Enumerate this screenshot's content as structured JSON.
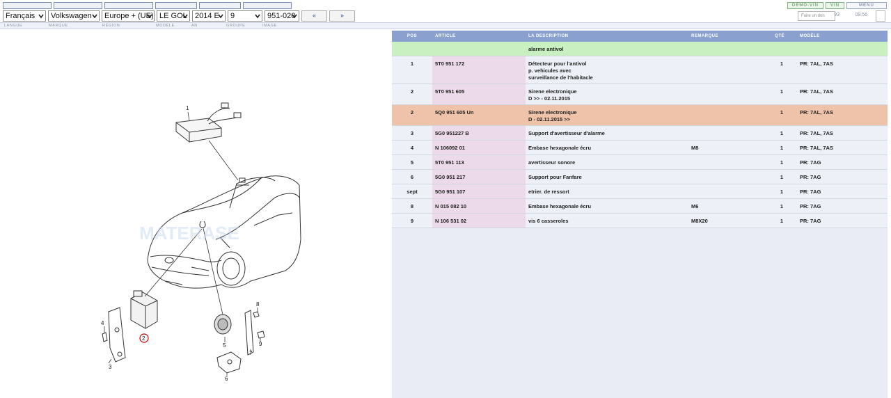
{
  "topbar": {
    "buttons": [
      "DÉMO-VIN",
      "VIN",
      "MENU"
    ]
  },
  "selectors": {
    "language": "Français",
    "brand": "Volkswagen",
    "region": "Europe + (UE)",
    "model": "LE GOL",
    "year": "2014 E",
    "group": "9",
    "image": "951-020",
    "prev": "«",
    "next": "»"
  },
  "labels": {
    "language": "LANGUE",
    "brand": "MARQUE",
    "region": "RÉGION",
    "model": "MODÈLE",
    "year": "AN",
    "group": "GROUPE",
    "image": "IMAGE"
  },
  "search": {
    "placeholder": "Faire un don"
  },
  "counters": {
    "a": "93",
    "b": "09:56"
  },
  "diagram": {
    "callouts": [
      "1",
      "2",
      "3",
      "4",
      "5",
      "6",
      "7",
      "8",
      "9"
    ]
  },
  "table": {
    "headers": {
      "pos": "POS",
      "article": "ARTICLE",
      "description": "LA DESCRIPTION",
      "remark": "REMARQUE",
      "qty": "QTÉ",
      "model": "MODÈLE"
    },
    "section": "alarme antivol",
    "rows": [
      {
        "pos": "1",
        "article": "5T0 951 172",
        "description": "Détecteur pour l'antivol\np. vehicules avec\nsurveillance de l'habitacle",
        "remark": "",
        "qty": "1",
        "model": "PR: 7AL, 7AS"
      },
      {
        "pos": "2",
        "article": "5T0 951 605",
        "description": "Sirene electronique\nD >> - 02.11.2015",
        "remark": "",
        "qty": "1",
        "model": "PR: 7AL, 7AS"
      },
      {
        "pos": "2",
        "article": "5Q0 951 605 Un",
        "description": "Sirene electronique\nD - 02.11.2015 >>",
        "remark": "",
        "qty": "1",
        "model": "PR: 7AL, 7AS"
      },
      {
        "pos": "3",
        "article": "5G0 951227 B",
        "description": "Support d'avertisseur d'alarme",
        "remark": "",
        "qty": "1",
        "model": "PR: 7AL, 7AS"
      },
      {
        "pos": "4",
        "article": "N 106092 01",
        "description": "Embase hexagonale écru",
        "remark": "M8",
        "qty": "1",
        "model": "PR: 7AL, 7AS"
      },
      {
        "pos": "5",
        "article": "5T0 951 113",
        "description": "avertisseur sonore",
        "remark": "",
        "qty": "1",
        "model": "PR: 7AG"
      },
      {
        "pos": "6",
        "article": "5G0 951 217",
        "description": "Support pour Fanfare",
        "remark": "",
        "qty": "1",
        "model": "PR: 7AG"
      },
      {
        "pos": "sept",
        "article": "5G0 951 107",
        "description": "etrier. de ressort",
        "remark": "",
        "qty": "1",
        "model": "PR: 7AG"
      },
      {
        "pos": "8",
        "article": "N 015 082 10",
        "description": "Embase hexagonale écru",
        "remark": "M6",
        "qty": "1",
        "model": "PR: 7AG"
      },
      {
        "pos": "9",
        "article": "N 106 531 02",
        "description": "vis 6 casseroles",
        "remark": "M8X20",
        "qty": "1",
        "model": "PR: 7AG"
      }
    ]
  },
  "colors": {
    "header": "#8aa0cf",
    "section": "#c8f0c0",
    "highlight": "#eec3aa",
    "article_cell": "#ecdaea"
  }
}
